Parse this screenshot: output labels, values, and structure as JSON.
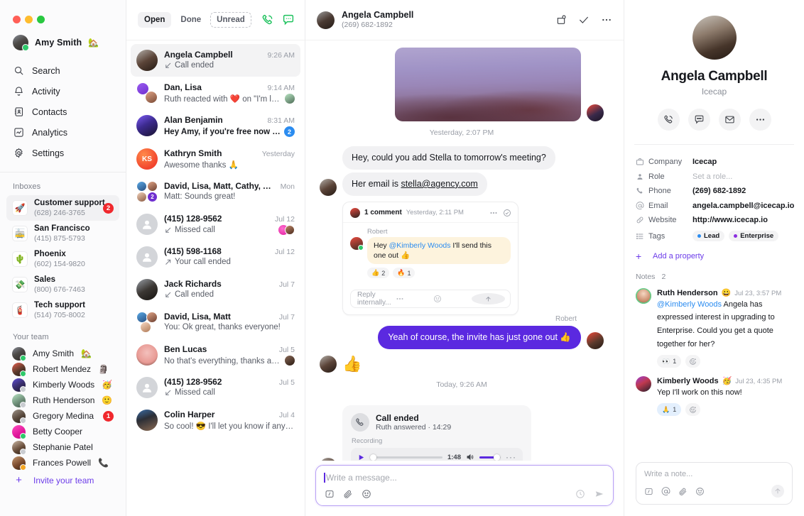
{
  "sidebar": {
    "user": {
      "name": "Amy Smith",
      "emoji": "🏡"
    },
    "nav": [
      {
        "label": "Search",
        "icon": "search-icon"
      },
      {
        "label": "Activity",
        "icon": "bell-icon"
      },
      {
        "label": "Contacts",
        "icon": "contacts-icon"
      },
      {
        "label": "Analytics",
        "icon": "analytics-icon"
      },
      {
        "label": "Settings",
        "icon": "gear-icon"
      }
    ],
    "inboxes_title": "Inboxes",
    "inboxes": [
      {
        "name": "Customer support",
        "number": "(628) 246-3765",
        "emoji": "🚀",
        "badge": "2",
        "active": true
      },
      {
        "name": "San Francisco",
        "number": "(415) 875-5793",
        "emoji": "🚋",
        "badge": ""
      },
      {
        "name": "Phoenix",
        "number": "(602) 154-9820",
        "emoji": "🌵",
        "badge": ""
      },
      {
        "name": "Sales",
        "number": "(800) 676-7463",
        "emoji": "💸",
        "badge": ""
      },
      {
        "name": "Tech support",
        "number": "(514) 705-8002",
        "emoji": "🧯",
        "badge": ""
      }
    ],
    "team_title": "Your team",
    "team": [
      {
        "name": "Amy Smith",
        "emoji": "🏡",
        "status": "on",
        "badge": ""
      },
      {
        "name": "Robert Mendez",
        "emoji": "🗿",
        "status": "on",
        "badge": ""
      },
      {
        "name": "Kimberly Woods",
        "emoji": "🥳",
        "status": "off",
        "badge": ""
      },
      {
        "name": "Ruth Henderson",
        "emoji": "🙂",
        "status": "off",
        "badge": ""
      },
      {
        "name": "Gregory Medina",
        "emoji": "",
        "status": "off",
        "badge": "1"
      },
      {
        "name": "Betty Cooper",
        "emoji": "",
        "status": "on",
        "badge": ""
      },
      {
        "name": "Stephanie Patel",
        "emoji": "",
        "status": "off",
        "badge": ""
      },
      {
        "name": "Frances Powell",
        "emoji": "📞",
        "status": "away",
        "badge": ""
      }
    ],
    "invite_label": "Invite your team"
  },
  "conversation_list": {
    "filters": [
      {
        "label": "Open",
        "state": "active"
      },
      {
        "label": "Done",
        "state": "normal"
      },
      {
        "label": "Unread",
        "state": "dashed"
      }
    ],
    "actions": [
      {
        "name": "new-call-icon"
      },
      {
        "name": "new-message-icon"
      }
    ],
    "items": [
      {
        "name": "Angela Campbell",
        "time": "9:26 AM",
        "preview": "Call ended",
        "status_icon": "call-incoming",
        "active": true,
        "bold": false,
        "badge": "",
        "avatars": []
      },
      {
        "name": "Dan, Lisa",
        "time": "9:14 AM",
        "preview": "Ruth reacted with ❤️ on \"I'm looking fo…",
        "status_icon": "",
        "active": false,
        "bold": false,
        "badge": "",
        "avatars": [
          "#6f8f7a"
        ]
      },
      {
        "name": "Alan Benjamin",
        "time": "8:31 AM",
        "preview": "Hey Amy, if you're free now we can ju…",
        "status_icon": "",
        "active": false,
        "bold": true,
        "badge": "2",
        "avatars": []
      },
      {
        "name": "Kathryn Smith",
        "time": "Yesterday",
        "preview": "Awesome thanks 🙏",
        "status_icon": "",
        "active": false,
        "bold": false,
        "badge": "",
        "avatars": []
      },
      {
        "name": "David, Lisa, Matt, Cathy, Alan",
        "time": "Mon",
        "preview": "Matt: Sounds great!",
        "status_icon": "",
        "active": false,
        "bold": false,
        "badge": "",
        "avatars": []
      },
      {
        "name": "(415) 128-9562",
        "time": "Jul 12",
        "preview": "Missed call",
        "status_icon": "call-missed",
        "active": false,
        "bold": false,
        "badge": "",
        "avatars": [
          "#ef3fa7",
          "#7a4b3c"
        ]
      },
      {
        "name": "(415) 598-1168",
        "time": "Jul 12",
        "preview": "Your call ended",
        "status_icon": "call-outgoing",
        "active": false,
        "bold": false,
        "badge": "",
        "avatars": []
      },
      {
        "name": "Jack Richards",
        "time": "Jul 7",
        "preview": "Call ended",
        "status_icon": "call-incoming",
        "active": false,
        "bold": false,
        "badge": "",
        "avatars": []
      },
      {
        "name": "David, Lisa, Matt",
        "time": "Jul 7",
        "preview": "You: Ok great, thanks everyone!",
        "status_icon": "",
        "active": false,
        "bold": false,
        "badge": "",
        "avatars": []
      },
      {
        "name": "Ben Lucas",
        "time": "Jul 5",
        "preview": "No that's everything, thanks again! 👌",
        "status_icon": "",
        "active": false,
        "bold": false,
        "badge": "",
        "avatars": [
          "#4a3228"
        ]
      },
      {
        "name": "(415) 128-9562",
        "time": "Jul 5",
        "preview": "Missed call",
        "status_icon": "call-missed",
        "active": false,
        "bold": false,
        "badge": "",
        "avatars": []
      },
      {
        "name": "Colin Harper",
        "time": "Jul 4",
        "preview": "So cool! 😎 I'll let you know if anything els…",
        "status_icon": "",
        "active": false,
        "bold": false,
        "badge": "",
        "avatars": []
      }
    ]
  },
  "main": {
    "header": {
      "name": "Angela Campbell",
      "phone": "(269) 682-1892"
    },
    "header_actions": [
      "snooze-icon",
      "check-icon",
      "more-icon"
    ],
    "day_separator_1": "Yesterday, 2:07 PM",
    "messages": [
      {
        "text": "Hey, could you add Stella to tomorrow's meeting?"
      },
      {
        "text": "Her email is ",
        "link": "stella@agency.com"
      }
    ],
    "comment": {
      "label": "1 comment",
      "time": "Yesterday, 2:11 PM",
      "author": "Robert",
      "text_before": "Hey ",
      "mention": "@Kimberly Woods",
      "text_after": " I'll send this one out 👍",
      "reactions": [
        {
          "emoji": "👍",
          "count": "2"
        },
        {
          "emoji": "🔥",
          "count": "1"
        }
      ],
      "reply_placeholder": "Reply internally..."
    },
    "outgoing": {
      "sender": "Robert",
      "text": "Yeah of course, the invite has just gone out 👍"
    },
    "reaction": "👍",
    "day_separator_2": "Today, 9:26 AM",
    "call_card": {
      "title": "Call ended",
      "subtitle": "Ruth answered · 14:29",
      "recording_label": "Recording",
      "duration": "1:48"
    },
    "composer": {
      "placeholder": "Write a message..."
    },
    "composer_icons": [
      "template-icon",
      "attachment-icon",
      "emoji-icon"
    ],
    "composer_right_icons": [
      "schedule-icon",
      "send-icon"
    ]
  },
  "right_panel": {
    "name": "Angela Campbell",
    "subtitle": "Icecap",
    "actions": [
      "call-icon",
      "message-icon",
      "email-icon",
      "more-icon"
    ],
    "properties": [
      {
        "icon": "briefcase-icon",
        "label": "Company",
        "value": "Icecap",
        "muted": false
      },
      {
        "icon": "person-icon",
        "label": "Role",
        "value": "Set a role...",
        "muted": true
      },
      {
        "icon": "phone-icon",
        "label": "Phone",
        "value": "(269) 682-1892",
        "muted": false
      },
      {
        "icon": "at-icon",
        "label": "Email",
        "value": "angela.campbell@icecap.io",
        "muted": false
      },
      {
        "icon": "link-icon",
        "label": "Website",
        "value": "http://www.icecap.io",
        "muted": false
      }
    ],
    "tags_label": "Tags",
    "tags": [
      {
        "label": "Lead",
        "color": "#2b8cf0"
      },
      {
        "label": "Enterprise",
        "color": "#8b2ee0"
      }
    ],
    "add_property_label": "Add a property",
    "notes_title": "Notes",
    "notes_count": "2",
    "notes": [
      {
        "author": "Ruth Henderson",
        "emoji": "😀",
        "time": "Jul 23, 3:57 PM",
        "mention": "@Kimberly Woods",
        "text": " Angela has expressed interest in upgrading to Enterprise. Could you get a quote together for her?",
        "reactions": [
          {
            "emoji": "👀",
            "count": "1",
            "style": "plain"
          }
        ]
      },
      {
        "author": "Kimberly Woods",
        "emoji": "🥳",
        "time": "Jul 23, 4:35 PM",
        "mention": "",
        "text": "Yep I'll work on this now!",
        "reactions": [
          {
            "emoji": "🙏",
            "count": "1",
            "style": "blue"
          }
        ]
      }
    ],
    "note_composer": {
      "placeholder": "Write a note..."
    },
    "note_icons": [
      "template-icon",
      "mention-icon",
      "attachment-icon",
      "emoji-icon"
    ]
  },
  "colors": {
    "accent": "#5b29e0",
    "accent_light": "#6c3ce9",
    "green": "#1cc15c",
    "red_badge": "#f0282d",
    "blue_badge": "#2b8cf0"
  }
}
